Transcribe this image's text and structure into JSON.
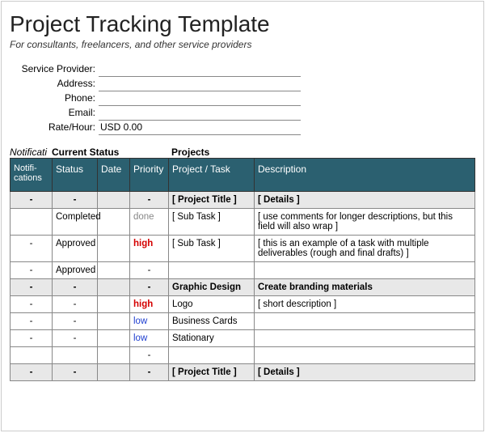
{
  "header": {
    "title": "Project Tracking Template",
    "subtitle": "For consultants, freelancers, and other service providers"
  },
  "info": {
    "provider_label": "Service Provider:",
    "address_label": "Address:",
    "phone_label": "Phone:",
    "email_label": "Email:",
    "rate_label": "Rate/Hour:",
    "provider_value": "",
    "address_value": "",
    "phone_value": "",
    "email_value": "",
    "rate_value": "USD 0.00"
  },
  "section_labels": {
    "notifications": "Notificati",
    "current_status": "Current Status",
    "projects": "Projects"
  },
  "columns": {
    "notif": "Notifi-cations",
    "status": "Status",
    "date": "Date",
    "priority": "Priority",
    "project": "Project / Task",
    "description": "Description"
  },
  "rows": [
    {
      "type": "section",
      "notif": "-",
      "status": "-",
      "date": "",
      "prio": "-",
      "prio_class": "",
      "proj": "[ Project Title ]",
      "desc": "[ Details ]"
    },
    {
      "type": "row",
      "notif": "",
      "status": "Completed",
      "status_class": "",
      "date": "",
      "prio": "done",
      "prio_class": "done",
      "proj": "[ Sub Task ]",
      "desc": "[ use comments for longer descriptions, but this field will also wrap ]"
    },
    {
      "type": "row",
      "notif": "-",
      "status": "Approved",
      "status_class": "approved",
      "date": "",
      "prio": "high",
      "prio_class": "high",
      "proj": "[ Sub Task ]",
      "desc": "[ this is an example of a task with multiple deliverables (rough and final drafts) ]"
    },
    {
      "type": "row",
      "notif": "-",
      "status": "Approved",
      "status_class": "approved",
      "date": "",
      "prio": "-",
      "prio_class": "",
      "proj": "",
      "desc": ""
    },
    {
      "type": "section",
      "notif": "-",
      "status": "-",
      "date": "",
      "prio": "-",
      "prio_class": "",
      "proj": "Graphic Design",
      "desc": "Create branding materials"
    },
    {
      "type": "row",
      "notif": "-",
      "status": "-",
      "status_class": "",
      "date": "",
      "prio": "high",
      "prio_class": "high",
      "proj": "Logo",
      "desc": "[ short description ]"
    },
    {
      "type": "row",
      "notif": "-",
      "status": "-",
      "status_class": "",
      "date": "",
      "prio": "low",
      "prio_class": "low",
      "proj": "Business Cards",
      "desc": ""
    },
    {
      "type": "row",
      "notif": "-",
      "status": "-",
      "status_class": "",
      "date": "",
      "prio": "low",
      "prio_class": "low",
      "proj": "Stationary",
      "desc": ""
    },
    {
      "type": "row",
      "notif": "",
      "status": "",
      "status_class": "",
      "date": "",
      "prio": "-",
      "prio_class": "",
      "proj": "",
      "desc": ""
    },
    {
      "type": "section",
      "notif": "-",
      "status": "-",
      "date": "",
      "prio": "-",
      "prio_class": "",
      "proj": "[ Project Title ]",
      "desc": "[ Details ]"
    }
  ]
}
